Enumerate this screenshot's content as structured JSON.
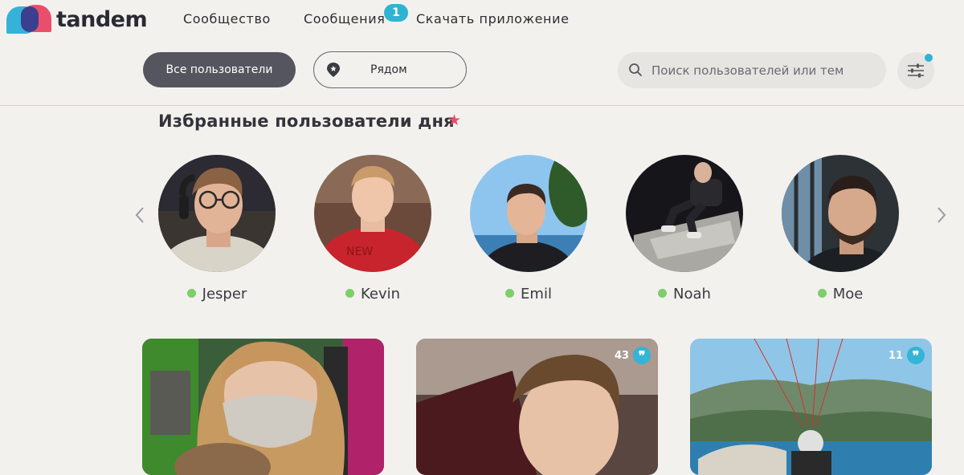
{
  "brand": {
    "name": "tandem"
  },
  "nav": {
    "community": "Сообщество",
    "messages": "Сообщения",
    "messages_badge": "1",
    "download": "Скачать приложение"
  },
  "filters": {
    "all_users": "Все пользователи",
    "nearby": "Рядом",
    "search_placeholder": "Поиск пользователей или тем"
  },
  "featured": {
    "title": "Избранные пользователи дня",
    "users": [
      {
        "name": "Jesper",
        "online": true
      },
      {
        "name": "Kevin",
        "online": true
      },
      {
        "name": "Emil",
        "online": true
      },
      {
        "name": "Noah",
        "online": true
      },
      {
        "name": "Moe",
        "online": true
      }
    ]
  },
  "cards": [
    {
      "count": ""
    },
    {
      "count": "43"
    },
    {
      "count": "11"
    }
  ],
  "colors": {
    "background": "#f3f1ee",
    "accent": "#2fb3d3",
    "brand_pink": "#e94f6b",
    "brand_blue": "#35b2d8",
    "online": "#7ccf69",
    "primary_button": "#55555f"
  },
  "icons": {
    "search": "search-icon",
    "settings": "sliders-icon",
    "nearby": "location-pin-icon",
    "prev": "chevron-left-icon",
    "next": "chevron-right-icon",
    "star": "star-icon",
    "quote": "quote-icon"
  }
}
